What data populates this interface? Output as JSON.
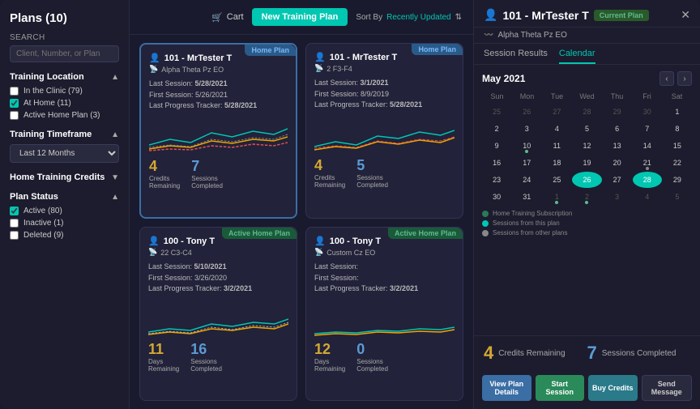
{
  "sidebar": {
    "title": "Plans (10)",
    "search": {
      "placeholder": "Client, Number, or Plan"
    },
    "sections": {
      "training_location": {
        "label": "Training Location",
        "options": [
          {
            "label": "In the Clinic (79)",
            "checked": false
          },
          {
            "label": "At Home (11)",
            "checked": true
          },
          {
            "label": "Active Home Plan (3)",
            "checked": false
          }
        ]
      },
      "training_timeframe": {
        "label": "Training Timeframe",
        "selected": "Last 12 Months"
      },
      "home_training_credits": {
        "label": "Home Training Credits"
      },
      "plan_status": {
        "label": "Plan Status",
        "options": [
          {
            "label": "Active (80)",
            "checked": true
          },
          {
            "label": "Inactive (1)",
            "checked": false
          },
          {
            "label": "Deleted (9)",
            "checked": false
          }
        ]
      }
    }
  },
  "header": {
    "cart_label": "Cart",
    "new_plan_label": "New Training Plan",
    "sort_by_label": "Sort By",
    "sort_value": "Recently Updated"
  },
  "plans": [
    {
      "id": "card1",
      "badge": "Home Plan",
      "badge_type": "home",
      "client": "101 - MrTester T",
      "subtitle": "Alpha Theta Pz EO",
      "last_session": "5/28/2021",
      "first_session": "5/26/2021",
      "last_progress": "5/28/2021",
      "stat1_num": "4",
      "stat1_label": "Credits\nRemaining",
      "stat2_num": "7",
      "stat2_label": "Sessions\nCompleted",
      "selected": true
    },
    {
      "id": "card2",
      "badge": "Home Plan",
      "badge_type": "home",
      "client": "101 - MrTester T",
      "subtitle": "2 F3-F4",
      "last_session": "3/1/2021",
      "first_session": "8/9/2019",
      "last_progress": "5/28/2021",
      "stat1_num": "4",
      "stat1_label": "Credits\nRemaining",
      "stat2_num": "5",
      "stat2_label": "Sessions\nCompleted",
      "selected": false
    },
    {
      "id": "card3",
      "badge": "Active Home Plan",
      "badge_type": "active",
      "client": "100 - Tony T",
      "subtitle": "22 C3-C4",
      "last_session": "5/10/2021",
      "first_session": "3/26/2020",
      "last_progress": "3/2/2021",
      "stat1_num": "11",
      "stat1_label": "Days\nRemaining",
      "stat2_num": "16",
      "stat2_label": "Sessions\nCompleted",
      "selected": false
    },
    {
      "id": "card4",
      "badge": "Active Home Plan",
      "badge_type": "active",
      "client": "100 - Tony T",
      "subtitle": "Custom Cz EO",
      "last_session": "",
      "first_session": "",
      "last_progress": "3/2/2021",
      "stat1_num": "12",
      "stat1_label": "Days\nRemaining",
      "stat2_num": "0",
      "stat2_label": "Sessions\nCompleted",
      "selected": false
    }
  ],
  "right_panel": {
    "title": "101 - MrTester T",
    "current_plan_label": "Current Plan",
    "subtitle": "Alpha Theta Pz EO",
    "tabs": [
      "Session Results",
      "Calendar"
    ],
    "active_tab": "Calendar",
    "calendar": {
      "month": "May 2021",
      "day_names": [
        "Sun",
        "Mon",
        "Tue",
        "Wed",
        "Thu",
        "Fri",
        "Sat"
      ],
      "days": [
        {
          "num": 25,
          "other": true,
          "dot": false,
          "highlight": false
        },
        {
          "num": 26,
          "other": true,
          "dot": false,
          "highlight": false
        },
        {
          "num": 27,
          "other": true,
          "dot": false,
          "highlight": false
        },
        {
          "num": 28,
          "other": true,
          "dot": false,
          "highlight": false
        },
        {
          "num": 29,
          "other": true,
          "dot": false,
          "highlight": false
        },
        {
          "num": 30,
          "other": true,
          "dot": false,
          "highlight": false
        },
        {
          "num": 1,
          "other": false,
          "dot": false,
          "highlight": false
        },
        {
          "num": 2,
          "other": false,
          "dot": false,
          "highlight": false
        },
        {
          "num": 3,
          "other": false,
          "dot": false,
          "highlight": false
        },
        {
          "num": 4,
          "other": false,
          "dot": false,
          "highlight": false
        },
        {
          "num": 5,
          "other": false,
          "dot": false,
          "highlight": false
        },
        {
          "num": 6,
          "other": false,
          "dot": false,
          "highlight": false
        },
        {
          "num": 7,
          "other": false,
          "dot": false,
          "highlight": false
        },
        {
          "num": 8,
          "other": false,
          "dot": false,
          "highlight": false
        },
        {
          "num": 9,
          "other": false,
          "dot": false,
          "highlight": false
        },
        {
          "num": 10,
          "other": false,
          "dot": "green",
          "highlight": false
        },
        {
          "num": 11,
          "other": false,
          "dot": false,
          "highlight": false
        },
        {
          "num": 12,
          "other": false,
          "dot": false,
          "highlight": false
        },
        {
          "num": 13,
          "other": false,
          "dot": false,
          "highlight": false
        },
        {
          "num": 14,
          "other": false,
          "dot": false,
          "highlight": false
        },
        {
          "num": 15,
          "other": false,
          "dot": false,
          "highlight": false
        },
        {
          "num": 16,
          "other": false,
          "dot": false,
          "highlight": false
        },
        {
          "num": 17,
          "other": false,
          "dot": false,
          "highlight": false
        },
        {
          "num": 18,
          "other": false,
          "dot": false,
          "highlight": false
        },
        {
          "num": 19,
          "other": false,
          "dot": false,
          "highlight": false
        },
        {
          "num": 20,
          "other": false,
          "dot": false,
          "highlight": false
        },
        {
          "num": 21,
          "other": false,
          "dot": "gray",
          "highlight": false
        },
        {
          "num": 22,
          "other": false,
          "dot": false,
          "highlight": false
        },
        {
          "num": 23,
          "other": false,
          "dot": false,
          "highlight": false
        },
        {
          "num": 24,
          "other": false,
          "dot": false,
          "highlight": false
        },
        {
          "num": 25,
          "other": false,
          "dot": false,
          "highlight": false
        },
        {
          "num": 26,
          "other": false,
          "dot": false,
          "highlight": "teal"
        },
        {
          "num": 27,
          "other": false,
          "dot": false,
          "highlight": false
        },
        {
          "num": 28,
          "other": false,
          "dot": false,
          "highlight": "teal"
        },
        {
          "num": 29,
          "other": false,
          "dot": false,
          "highlight": false
        },
        {
          "num": 30,
          "other": false,
          "dot": false,
          "highlight": false
        },
        {
          "num": 31,
          "other": false,
          "dot": false,
          "highlight": false
        },
        {
          "num": 1,
          "other": true,
          "dot": false,
          "highlight": false
        },
        {
          "num": 2,
          "other": true,
          "dot": "green",
          "highlight": false
        },
        {
          "num": 3,
          "other": true,
          "dot": false,
          "highlight": false
        },
        {
          "num": 4,
          "other": true,
          "dot": false,
          "highlight": false
        },
        {
          "num": 5,
          "other": true,
          "dot": false,
          "highlight": false
        }
      ]
    },
    "legend": [
      {
        "color": "#2a7a5a",
        "label": "Home Training Subscription"
      },
      {
        "color": "#00c7b1",
        "label": "Sessions from this plan"
      },
      {
        "color": "#888",
        "label": "Sessions from other plans"
      }
    ],
    "credits_remaining": "4",
    "credits_label": "Credits Remaining",
    "sessions_completed": "7",
    "sessions_label": "Sessions Completed",
    "actions": [
      {
        "label": "View Plan Details",
        "type": "blue"
      },
      {
        "label": "Start Session",
        "type": "green"
      },
      {
        "label": "Buy Credits",
        "type": "teal"
      },
      {
        "label": "Send Message",
        "type": "outline"
      }
    ]
  }
}
